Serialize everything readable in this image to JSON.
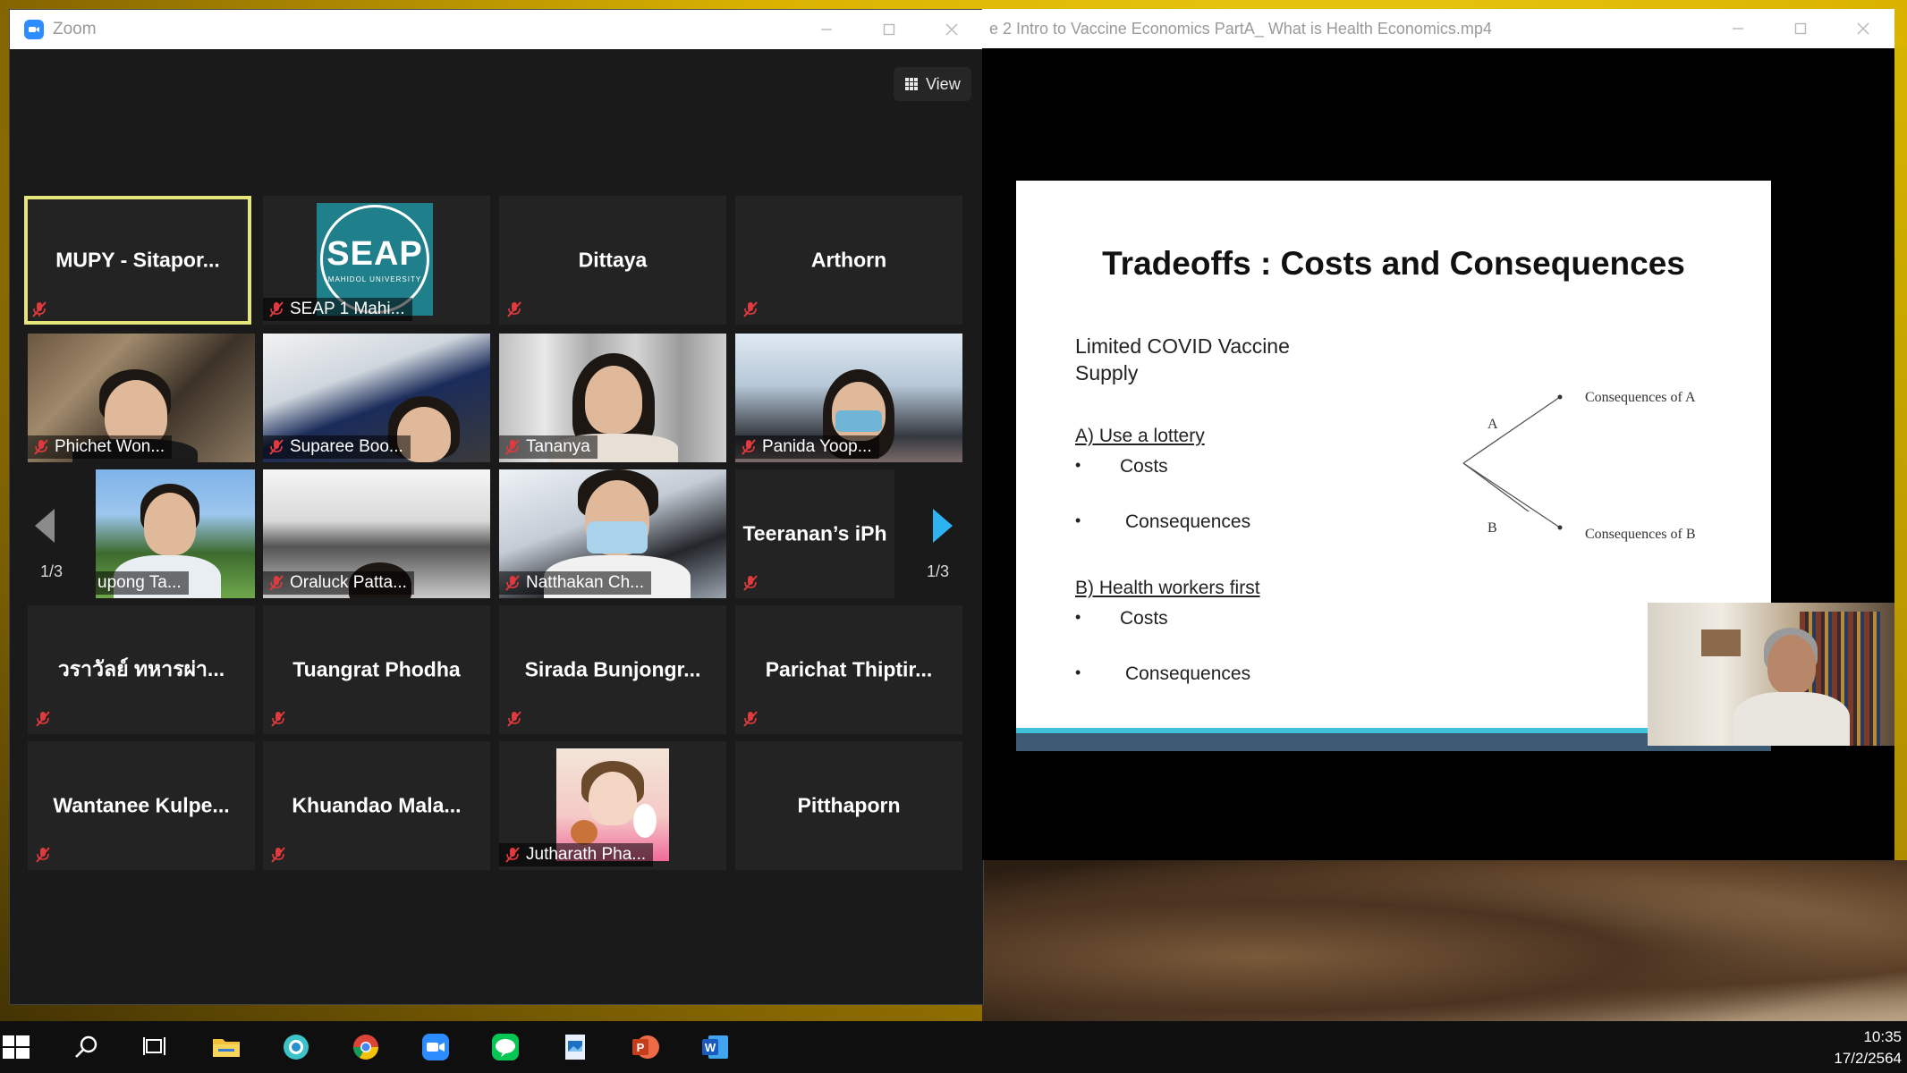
{
  "zoom": {
    "window_title": "Zoom",
    "view_label": "View",
    "page_left": "1/3",
    "page_right": "1/3",
    "tiles": [
      {
        "name": "MUPY - Sitapor...",
        "type": "name"
      },
      {
        "name": "SEAP 1 Mahi...",
        "type": "logo"
      },
      {
        "name": "Dittaya",
        "type": "name"
      },
      {
        "name": "Arthorn",
        "type": "name"
      },
      {
        "name": "Phichet Won...",
        "type": "video"
      },
      {
        "name": "Suparee Boo...",
        "type": "video"
      },
      {
        "name": "Tananya",
        "type": "video"
      },
      {
        "name": "Panida Yoop...",
        "type": "video"
      },
      {
        "name": "upong Ta...",
        "type": "video"
      },
      {
        "name": "Oraluck Patta...",
        "type": "video"
      },
      {
        "name": "Natthakan Ch...",
        "type": "video"
      },
      {
        "name": "Teeranan’s iPh",
        "type": "name"
      },
      {
        "name": "วราวัลย์ ทหารผ่า...",
        "type": "name"
      },
      {
        "name": "Tuangrat Phodha",
        "type": "name"
      },
      {
        "name": "Sirada Bunjongr...",
        "type": "name"
      },
      {
        "name": "Parichat Thiptir...",
        "type": "name"
      },
      {
        "name": "Wantanee Kulpe...",
        "type": "name"
      },
      {
        "name": "Khuandao Mala...",
        "type": "name"
      },
      {
        "name": "Jutharath Pha...",
        "type": "avatar"
      },
      {
        "name": "Pitthaporn",
        "type": "name"
      }
    ],
    "seap_logo_text": "SEAP",
    "seap_logo_sub": "MAHIDOL UNIVERSITY"
  },
  "player": {
    "window_title": "e 2 Intro to Vaccine Economics PartA_ What is Health Economics.mp4"
  },
  "slide": {
    "title": "Tradeoffs : Costs and Consequences",
    "line1": "Limited COVID Vaccine",
    "line2": "Supply",
    "option_a": "A)  Use a lottery",
    "a_costs": "Costs",
    "a_consequences": "Consequences",
    "option_b": "B)   Health workers first",
    "b_costs": "Costs",
    "b_consequences": "Consequences",
    "bullet": "•",
    "branch_a": "A",
    "branch_b": "B",
    "cons_a": "Consequences of A",
    "cons_b": "Consequences of B"
  },
  "taskbar": {
    "time": "10:35",
    "date": "17/2/2564",
    "icons": [
      "start-icon",
      "search-icon",
      "task-view-icon",
      "file-explorer-icon",
      "edge-like-icon",
      "chrome-icon",
      "zoom-app-icon",
      "line-app-icon",
      "photos-icon",
      "powerpoint-icon",
      "word-icon"
    ]
  },
  "colors": {
    "zoom_blue": "#2d8cff",
    "active_speaker": "#e5e57a",
    "muted_red": "#e0393e",
    "slide_cyan": "#3fc3d8",
    "slide_navy": "#3c5a73"
  }
}
